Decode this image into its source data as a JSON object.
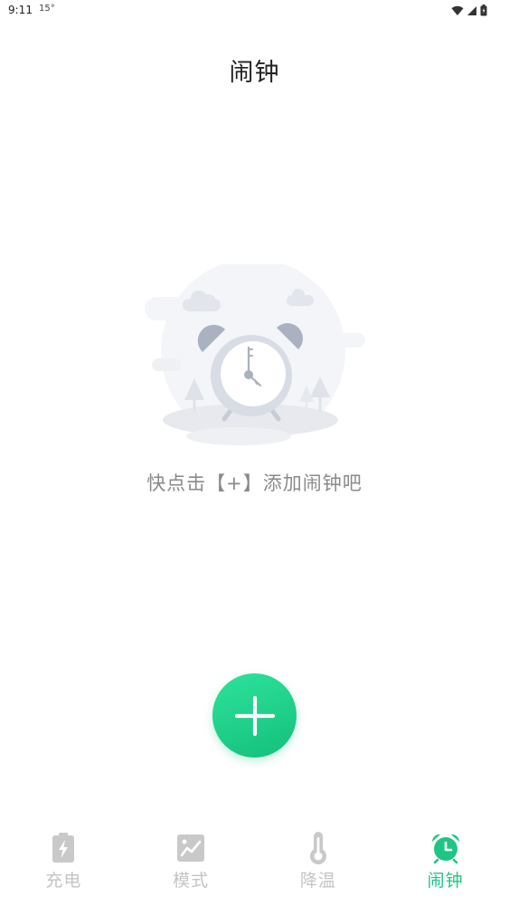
{
  "status_bar": {
    "time": "9:11",
    "extra": "15°"
  },
  "header": {
    "title": "闹钟"
  },
  "empty_state": {
    "hint": "快点击【+】添加闹钟吧"
  },
  "fab": {
    "icon": "plus-icon"
  },
  "tabs": [
    {
      "label": "充电",
      "icon": "battery-charging-icon",
      "active": false
    },
    {
      "label": "模式",
      "icon": "picture-icon",
      "active": false
    },
    {
      "label": "降温",
      "icon": "thermometer-icon",
      "active": false
    },
    {
      "label": "闹钟",
      "icon": "alarm-clock-icon",
      "active": true
    }
  ],
  "colors": {
    "accent": "#1FC585",
    "inactive": "#C4C4C4",
    "hint": "#8A8A8A"
  }
}
